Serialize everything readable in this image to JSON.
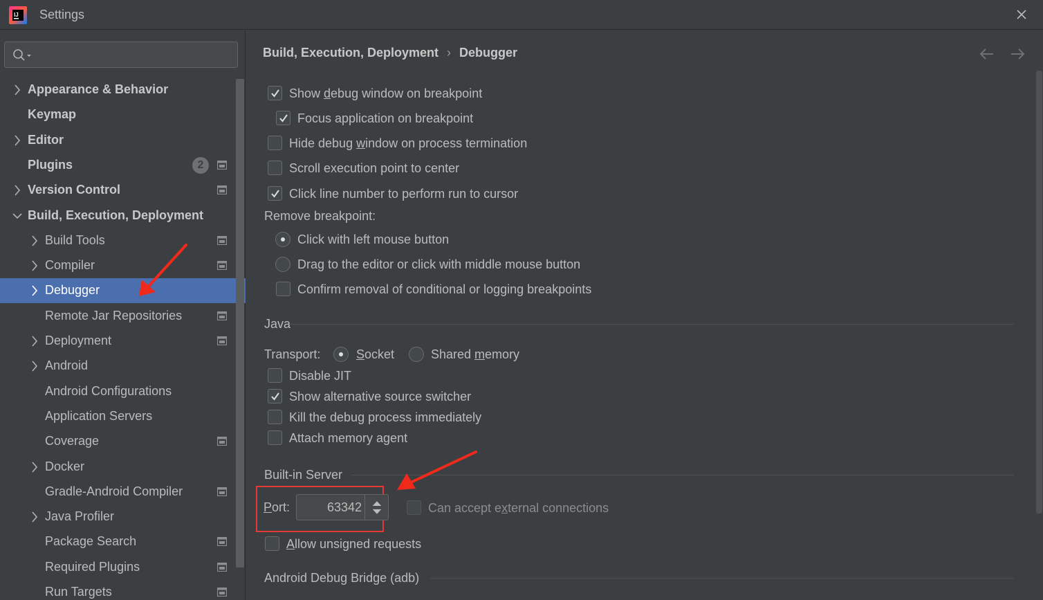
{
  "window": {
    "title": "Settings",
    "app_logo": "intellij-idea-logo"
  },
  "sidebar": {
    "search": {
      "value": "",
      "placeholder": ""
    },
    "items": [
      {
        "label": "Appearance & Behavior",
        "level": 0,
        "expandable": true,
        "expanded": false,
        "project_icon": false
      },
      {
        "label": "Keymap",
        "level": 0,
        "expandable": false,
        "project_icon": false
      },
      {
        "label": "Editor",
        "level": 0,
        "expandable": true,
        "expanded": false,
        "project_icon": false
      },
      {
        "label": "Plugins",
        "level": 0,
        "expandable": false,
        "project_icon": true,
        "badge": "2"
      },
      {
        "label": "Version Control",
        "level": 0,
        "expandable": true,
        "expanded": false,
        "project_icon": true
      },
      {
        "label": "Build, Execution, Deployment",
        "level": 0,
        "expandable": true,
        "expanded": true,
        "project_icon": false
      },
      {
        "label": "Build Tools",
        "level": 1,
        "expandable": true,
        "project_icon": true
      },
      {
        "label": "Compiler",
        "level": 1,
        "expandable": true,
        "project_icon": true
      },
      {
        "label": "Debugger",
        "level": 1,
        "expandable": true,
        "project_icon": false,
        "selected": true
      },
      {
        "label": "Remote Jar Repositories",
        "level": 1,
        "expandable": false,
        "project_icon": true
      },
      {
        "label": "Deployment",
        "level": 1,
        "expandable": true,
        "project_icon": true
      },
      {
        "label": "Android",
        "level": 1,
        "expandable": true,
        "project_icon": false
      },
      {
        "label": "Android Configurations",
        "level": 1,
        "expandable": false,
        "project_icon": false
      },
      {
        "label": "Application Servers",
        "level": 1,
        "expandable": false,
        "project_icon": false
      },
      {
        "label": "Coverage",
        "level": 1,
        "expandable": false,
        "project_icon": true
      },
      {
        "label": "Docker",
        "level": 1,
        "expandable": true,
        "project_icon": false
      },
      {
        "label": "Gradle-Android Compiler",
        "level": 1,
        "expandable": false,
        "project_icon": true
      },
      {
        "label": "Java Profiler",
        "level": 1,
        "expandable": true,
        "project_icon": false
      },
      {
        "label": "Package Search",
        "level": 1,
        "expandable": false,
        "project_icon": true
      },
      {
        "label": "Required Plugins",
        "level": 1,
        "expandable": false,
        "project_icon": true
      },
      {
        "label": "Run Targets",
        "level": 1,
        "expandable": false,
        "project_icon": true
      }
    ]
  },
  "breadcrumb": {
    "parent": "Build, Execution, Deployment",
    "separator": "›",
    "current": "Debugger"
  },
  "debugger": {
    "show_debug_window": {
      "pre": "Show ",
      "mn": "d",
      "post": "ebug window on breakpoint",
      "checked": true
    },
    "focus_application": {
      "label": "Focus application on breakpoint",
      "checked": true
    },
    "hide_debug_window": {
      "pre": "Hide debug ",
      "mn": "w",
      "post": "indow on process termination",
      "checked": false
    },
    "scroll_execution": {
      "label": "Scroll execution point to center",
      "checked": false
    },
    "click_line_number": {
      "label": "Click line number to perform run to cursor",
      "checked": true
    },
    "remove_breakpoint": {
      "title": "Remove breakpoint:",
      "click_left": {
        "label": "Click with left mouse button",
        "selected": true
      },
      "drag_editor": {
        "label": "Drag to the editor or click with middle mouse button",
        "selected": false
      },
      "confirm_removal": {
        "label": "Confirm removal of conditional or logging breakpoints",
        "checked": false
      }
    },
    "java": {
      "title": "Java",
      "transport_label": "Transport:",
      "socket": {
        "mn": "S",
        "post": "ocket",
        "selected": true
      },
      "shared_memory": {
        "pre": "Shared ",
        "mn": "m",
        "post": "emory",
        "selected": false
      },
      "disable_jit": {
        "label": "Disable JIT",
        "checked": false
      },
      "show_alt_source": {
        "label": "Show alternative source switcher",
        "checked": true
      },
      "kill_debug": {
        "label": "Kill the debug process immediately",
        "checked": false
      },
      "attach_memory": {
        "label": "Attach memory agent",
        "checked": false
      }
    },
    "builtin_server": {
      "title": "Built-in Server",
      "port_label_mn": "P",
      "port_label_post": "ort:",
      "port_value": "63342",
      "accept_external": {
        "pre": "Can accept e",
        "mn": "x",
        "post": "ternal connections",
        "checked": false,
        "enabled": false
      },
      "allow_unsigned": {
        "mn": "A",
        "post": "llow unsigned requests",
        "checked": false
      }
    },
    "adb": {
      "title": "Android Debug Bridge (adb)"
    }
  },
  "colors": {
    "background": "#3c3f41",
    "selection": "#4b6eaf",
    "annotation_red": "#e53935",
    "text": "#bbbbbb"
  }
}
